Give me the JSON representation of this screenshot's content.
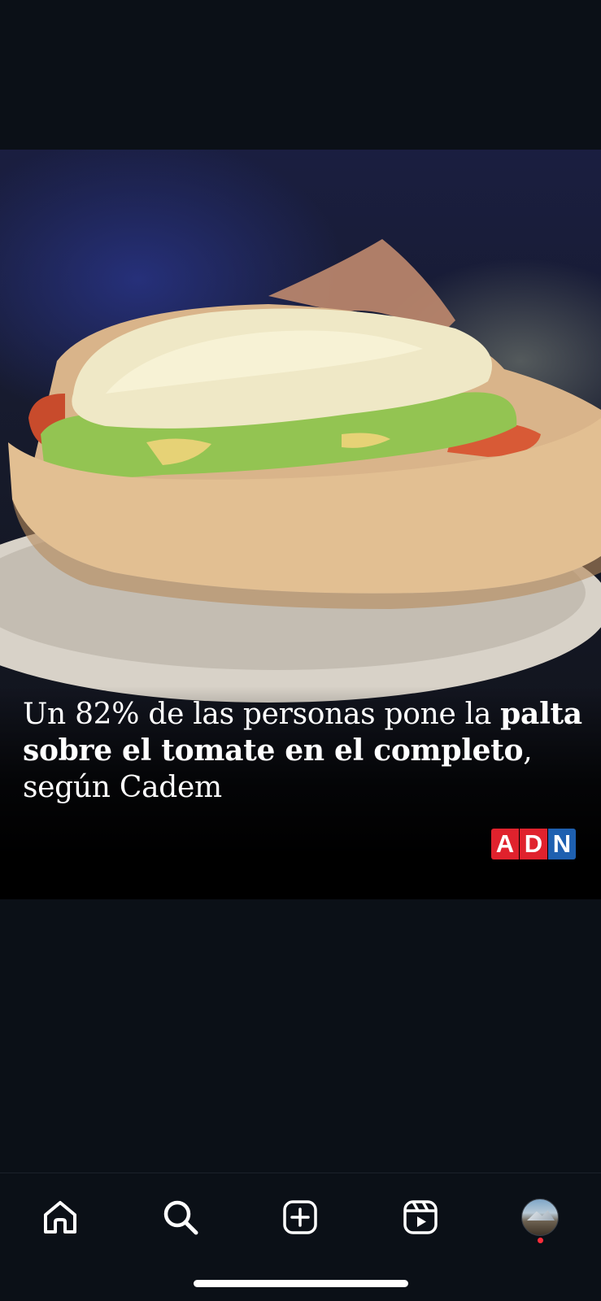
{
  "post": {
    "headline": {
      "part1": "Un 82% de las personas pone la ",
      "bold1": "palta sobre el tomate en el completo",
      "part2": ", según Cadem"
    },
    "logo": {
      "text": "ADN",
      "colors": [
        "#e0222d",
        "#e0222d",
        "#1e60b0"
      ]
    }
  },
  "tab_bar": {
    "items": [
      {
        "name": "home",
        "icon": "home-icon"
      },
      {
        "name": "search",
        "icon": "search-icon"
      },
      {
        "name": "create",
        "icon": "plus-square-icon"
      },
      {
        "name": "reels",
        "icon": "reels-icon"
      },
      {
        "name": "profile",
        "icon": "avatar"
      }
    ],
    "profile_notification": true
  },
  "colors": {
    "background": "#0b1017",
    "notification_dot": "#ff2d3a",
    "icon": "#ffffff"
  }
}
